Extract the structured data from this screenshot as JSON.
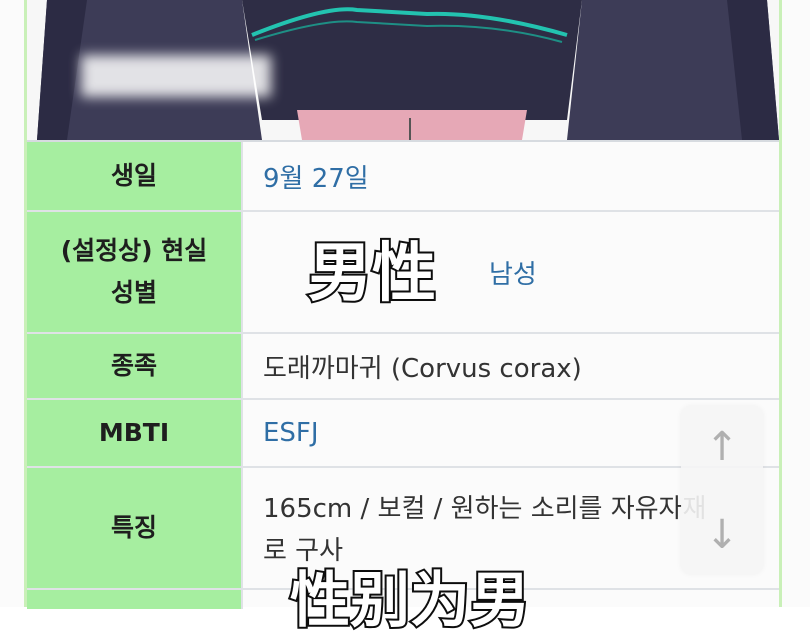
{
  "table": {
    "rows": [
      {
        "label": "생일",
        "value": "9월 27일",
        "link": true
      },
      {
        "label_line1": "(설정상) 현실",
        "label_line2": "성별",
        "value": "남성",
        "link": true
      },
      {
        "label": "종족",
        "value": "도래까마귀 (Corvus corax)",
        "link": false
      },
      {
        "label": "MBTI",
        "value": "ESFJ",
        "link": true
      },
      {
        "label": "특징",
        "value_line1": "165cm / 보컬 / 원하는 소리를 자유자재",
        "value_line2": "로 구사",
        "link": false
      }
    ]
  },
  "overlay": {
    "caption_gender": "男性",
    "caption_bottom": "性别为男"
  },
  "scroll_controls": {
    "up_icon": "arrow-up-icon",
    "down_icon": "arrow-down-icon"
  },
  "colors": {
    "header_bg": "#a6eea0",
    "link": "#2f6ea5",
    "art_dark": "#3b3a55",
    "art_accent": "#23c3b0"
  }
}
